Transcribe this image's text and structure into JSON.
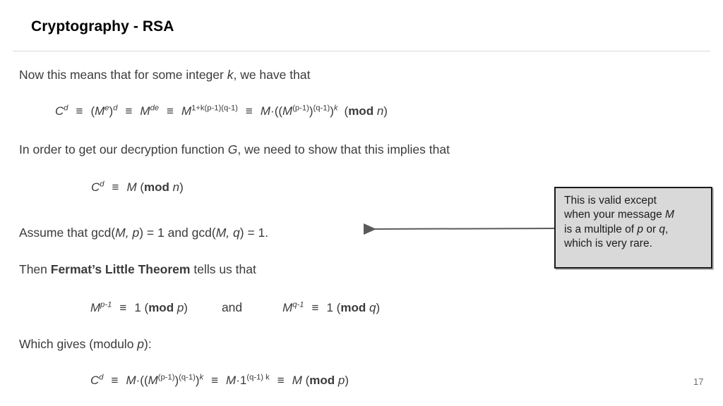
{
  "slide": {
    "title": "Cryptography - RSA",
    "page_number": "17"
  },
  "body": {
    "line1_pre": "Now this means that for some integer ",
    "line1_var": "k",
    "line1_post": ", we have that",
    "line3_pre": "In order to get our decryption function ",
    "line3_var": "G",
    "line3_post": ", we need to show that this implies that",
    "line5_pre": "Assume that gcd(",
    "line5_var1": "M, p",
    "line5_mid": ") = 1 and gcd(",
    "line5_var2": "M, q",
    "line5_post": ") = 1.",
    "line6_pre": "Then ",
    "line6_bold": "Fermat’s Little Theorem",
    "line6_post": " tells us that",
    "line8_pre": "Which gives (modulo ",
    "line8_var": "p",
    "line8_post": "):"
  },
  "equations": {
    "eq1": {
      "t1_base": "C",
      "t1_exp": "d",
      "op1": "≡",
      "t2_open": "(",
      "t2_base": "M",
      "t2_exp": "e",
      "t2_close": ")",
      "t2_outer_exp": "d",
      "op2": "≡",
      "t3_base": "M",
      "t3_exp": "de",
      "op3": "≡",
      "t4_base": "M",
      "t4_exp": "1+k(p-1)(q-1)",
      "op4": "≡",
      "t5_base": "M",
      "t5_dot": "·",
      "t5_open": "((",
      "t5_inner": "M",
      "t5_inner_exp": "(p-1)",
      "t5_mid": ")",
      "t5_second_exp": "(q-1)",
      "t5_close": ")",
      "t5_outer_exp": "k",
      "t6_open": "(",
      "t6_mod": "mod",
      "t6_n": "n",
      "t6_close": ")"
    },
    "eq2": {
      "t1_base": "C",
      "t1_exp": "d",
      "op1": "≡",
      "t2": "M",
      "t3_open": "(",
      "t3_mod": "mod",
      "t3_n": "n",
      "t3_close": ")"
    },
    "eq3": {
      "left_base": "M",
      "left_exp": "p-1",
      "left_op": "≡",
      "left_one": "1",
      "left_open": "(",
      "left_mod": "mod",
      "left_var": "p",
      "left_close": ")",
      "conjunction": "and",
      "right_base": "M",
      "right_exp": "q-1",
      "right_op": "≡",
      "right_one": "1",
      "right_open": "(",
      "right_mod": "mod",
      "right_var": "q",
      "right_close": ")"
    },
    "eq4": {
      "t1_base": "C",
      "t1_exp": "d",
      "op1": "≡",
      "t2_base": "M",
      "t2_dot": "·",
      "t2_open": "((",
      "t2_inner": "M",
      "t2_inner_exp": "(p-1)",
      "t2_mid": ")",
      "t2_second_exp": "(q-1)",
      "t2_close": ")",
      "t2_outer_exp": "k",
      "op2": "≡",
      "t3_base": "M",
      "t3_dot": "·",
      "t3_one": "1",
      "t3_exp": "(q-1) k",
      "op3": "≡",
      "t4": "M",
      "t5_open": "(",
      "t5_mod": "mod",
      "t5_var": "p",
      "t5_close": ")"
    }
  },
  "callout": {
    "line1_pre": "This is valid except",
    "line2_pre": "when your message ",
    "line2_var": "M",
    "line3_pre": "is a multiple of ",
    "line3_var1": "p",
    "line3_mid": " or ",
    "line3_var2": "q",
    "line3_post": ",",
    "line4": "which is very rare.",
    "border_color": "#1a1a1a",
    "fill_color": "#d9d9d9",
    "arrow_color": "#5a5a5a"
  }
}
